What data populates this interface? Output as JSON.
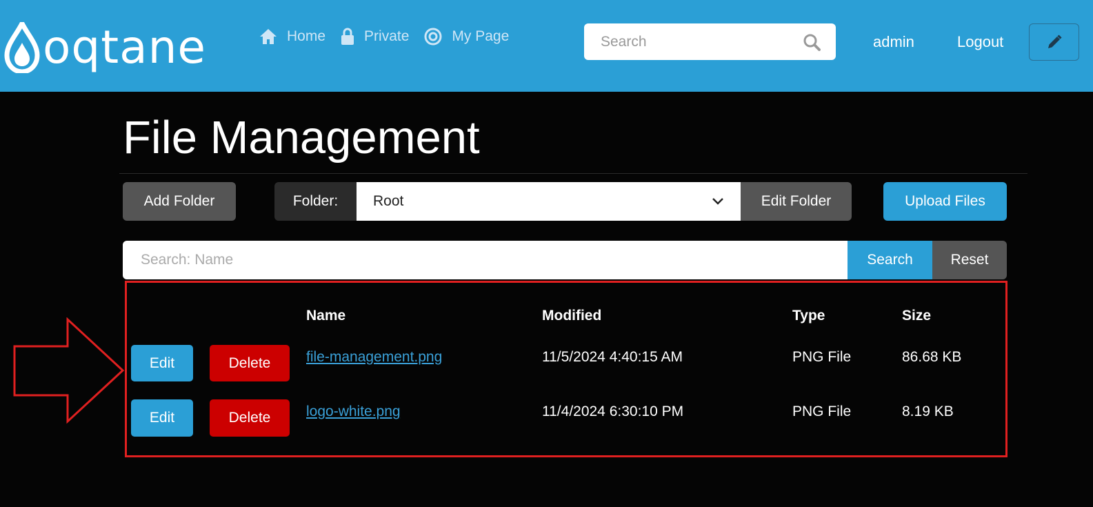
{
  "header": {
    "logo_text": "oqtane",
    "nav": [
      {
        "label": "Home",
        "icon": "home-icon"
      },
      {
        "label": "Private",
        "icon": "lock-icon"
      },
      {
        "label": "My Page",
        "icon": "target-icon"
      }
    ],
    "search_placeholder": "Search",
    "user": "admin",
    "logout": "Logout",
    "accent_color": "#2b9fd6"
  },
  "page": {
    "title": "File Management",
    "add_folder": "Add Folder",
    "folder_label": "Folder:",
    "folder_value": "Root",
    "edit_folder": "Edit Folder",
    "upload_files": "Upload Files",
    "name_search_placeholder": "Search: Name",
    "search_button": "Search",
    "reset_button": "Reset"
  },
  "table": {
    "columns": {
      "name": "Name",
      "modified": "Modified",
      "type": "Type",
      "size": "Size"
    },
    "edit_label": "Edit",
    "delete_label": "Delete",
    "rows": [
      {
        "name": "file-management.png",
        "modified": "11/5/2024 4:40:15 AM",
        "type": "PNG File",
        "size": "86.68 KB"
      },
      {
        "name": "logo-white.png",
        "modified": "11/4/2024 6:30:10 PM",
        "type": "PNG File",
        "size": "8.19 KB"
      }
    ]
  },
  "annotation_color": "#e02020"
}
